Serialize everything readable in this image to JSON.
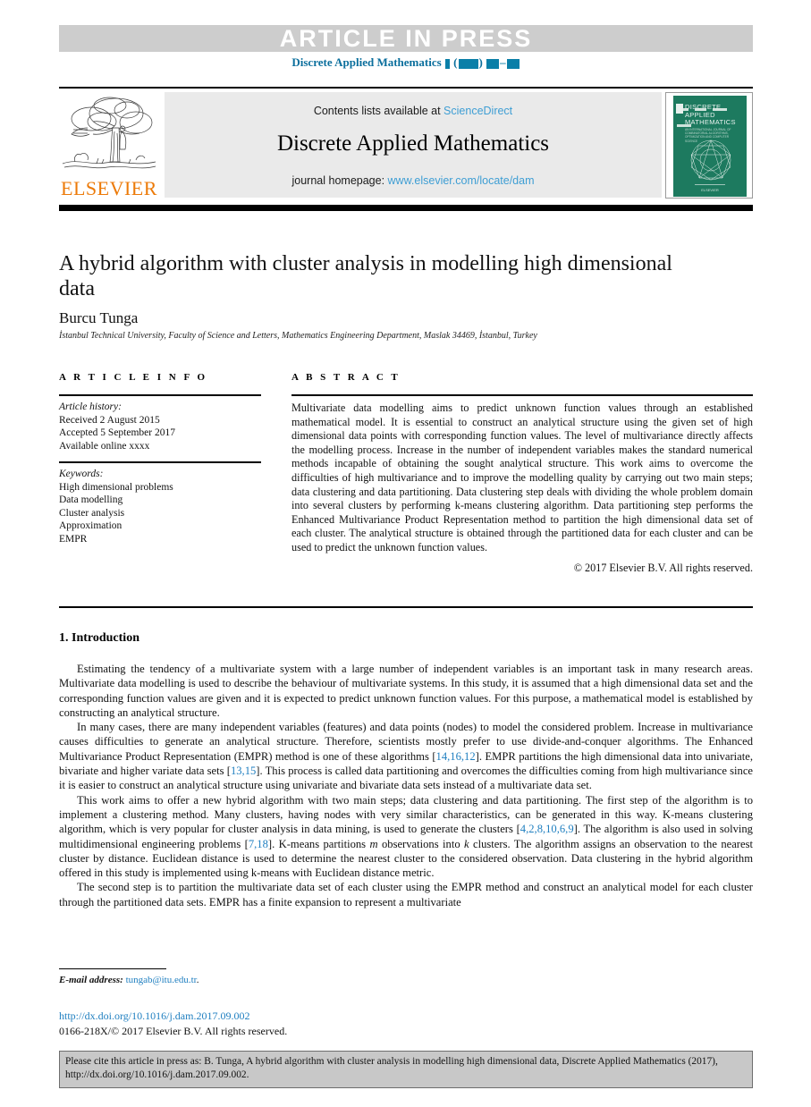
{
  "header": {
    "article_in_press": "ARTICLE IN PRESS",
    "journal_ref_prefix": "Discrete Applied Mathematics",
    "journal_ref_dash": "–"
  },
  "masthead": {
    "publisher": "ELSEVIER",
    "contents_prefix": "Contents lists available at ",
    "contents_link": "ScienceDirect",
    "journal_title": "Discrete Applied Mathematics",
    "homepage_prefix": "journal homepage: ",
    "homepage_link": "www.elsevier.com/locate/dam",
    "cover": {
      "line1": "DISCRETE",
      "line2": "APPLIED",
      "line3": "MATHEMATICS",
      "subtitle": "AN INTERNATIONAL JOURNAL OF COMBINATORIAL ALGORITHMS, OPTIMIZATION AND COMPUTER SCIENCE",
      "footer": "ELSEVIER"
    }
  },
  "article": {
    "title": "A hybrid algorithm with cluster analysis in modelling high dimensional data",
    "author": "Burcu Tunga",
    "affiliation": "İstanbul Technical University, Faculty of Science and Letters, Mathematics Engineering Department, Maslak 34469, İstanbul, Turkey"
  },
  "info": {
    "heading": "A R T I C L E   I N F O",
    "history_label": "Article history:",
    "received": "Received 2 August 2015",
    "accepted": "Accepted 5 September 2017",
    "available": "Available online xxxx",
    "keywords_label": "Keywords:",
    "keywords": [
      "High dimensional problems",
      "Data modelling",
      "Cluster analysis",
      "Approximation",
      "EMPR"
    ]
  },
  "abstract": {
    "heading": "A B S T R A C T",
    "body": "Multivariate data modelling aims to predict unknown function values through an established mathematical model. It is essential to construct an analytical structure using the given set of high dimensional data points with corresponding function values. The level of multivariance directly affects the modelling process. Increase in the number of independent variables makes the standard numerical methods incapable of obtaining the sought analytical structure. This work aims to overcome the difficulties of high multivariance and to improve the modelling quality by carrying out two main steps; data clustering and data partitioning. Data clustering step deals with dividing the whole problem domain into several clusters by performing k-means clustering algorithm. Data partitioning step performs the Enhanced Multivariance Product Representation method to partition the high dimensional data set of each cluster. The analytical structure is obtained through the partitioned data for each cluster and can be used to predict the unknown function values.",
    "copyright": "© 2017 Elsevier B.V. All rights reserved."
  },
  "intro": {
    "heading": "1.  Introduction",
    "p1": "Estimating the tendency of a multivariate system with a large   number of independent variables is an important task in many research areas. Multivariate data modelling is used to describe the behaviour of multivariate systems. In this study, it is assumed that a high dimensional data set and the corresponding function values are given and it is expected to predict unknown function values. For this purpose, a mathematical model is established by constructing an analytical structure.",
    "p2a": "In many cases, there are many independent variables (features) and data points (nodes) to model the considered problem. Increase in multivariance causes difficulties to generate an analytical structure. Therefore, scientists mostly prefer to use divide-and-conquer algorithms. The Enhanced Multivariance Product Representation (EMPR) method is one of these algorithms [",
    "p2_cite1": "14,16,12",
    "p2b": "]. EMPR partitions the high dimensional data into univariate, bivariate and higher variate data sets [",
    "p2_cite2": "13,15",
    "p2c": "]. This process is called data partitioning and overcomes the difficulties coming from high multivariance since it is easier to construct an analytical structure using univariate and bivariate data sets instead of a multivariate data set.",
    "p3a": "This work aims to offer a new hybrid algorithm with two main steps; data clustering and data partitioning. The first step of the algorithm is to implement a clustering method. Many clusters, having nodes with very similar characteristics, can be generated in this way. K-means clustering algorithm, which is very popular for cluster analysis in data mining, is used to generate the clusters [",
    "p3_cite1": "4,2,8,10,6,9",
    "p3b": "]. The algorithm is also used in solving multidimensional engineering problems [",
    "p3_cite2": "7,18",
    "p3c": "]. K-means partitions ",
    "p3_m": "m",
    "p3d": " observations into ",
    "p3_k": "k",
    "p3e": " clusters. The algorithm assigns an observation to the nearest cluster by distance. Euclidean distance is used to determine the nearest cluster to the considered observation. Data clustering in the hybrid algorithm offered in this study is implemented using k-means with Euclidean distance metric.",
    "p4": "The second step is to partition the multivariate data set of each cluster using the EMPR method and construct an analytical model for each cluster through the partitioned data sets. EMPR has a finite expansion to represent a multivariate"
  },
  "footnote": {
    "email_label": "E-mail address:",
    "email": "tungab@itu.edu.tr",
    "email_suffix": ".",
    "doi": "http://dx.doi.org/10.1016/j.dam.2017.09.002",
    "issn": "0166-218X/© 2017 Elsevier B.V. All rights reserved."
  },
  "cite_box": {
    "text": "Please cite this article in press as: B. Tunga, A hybrid algorithm with cluster analysis in modelling high dimensional data, Discrete Applied Mathematics (2017), http://dx.doi.org/10.1016/j.dam.2017.09.002."
  },
  "colors": {
    "band_gray": "#cdcdcd",
    "journal_blue": "#0b6f9d",
    "link_blue": "#3e9ed4",
    "cite_blue": "#1f7fc0",
    "elsevier_orange": "#ec7a08",
    "cover_green": "#1d7a5f",
    "box_gray": "#c8c8c8"
  }
}
